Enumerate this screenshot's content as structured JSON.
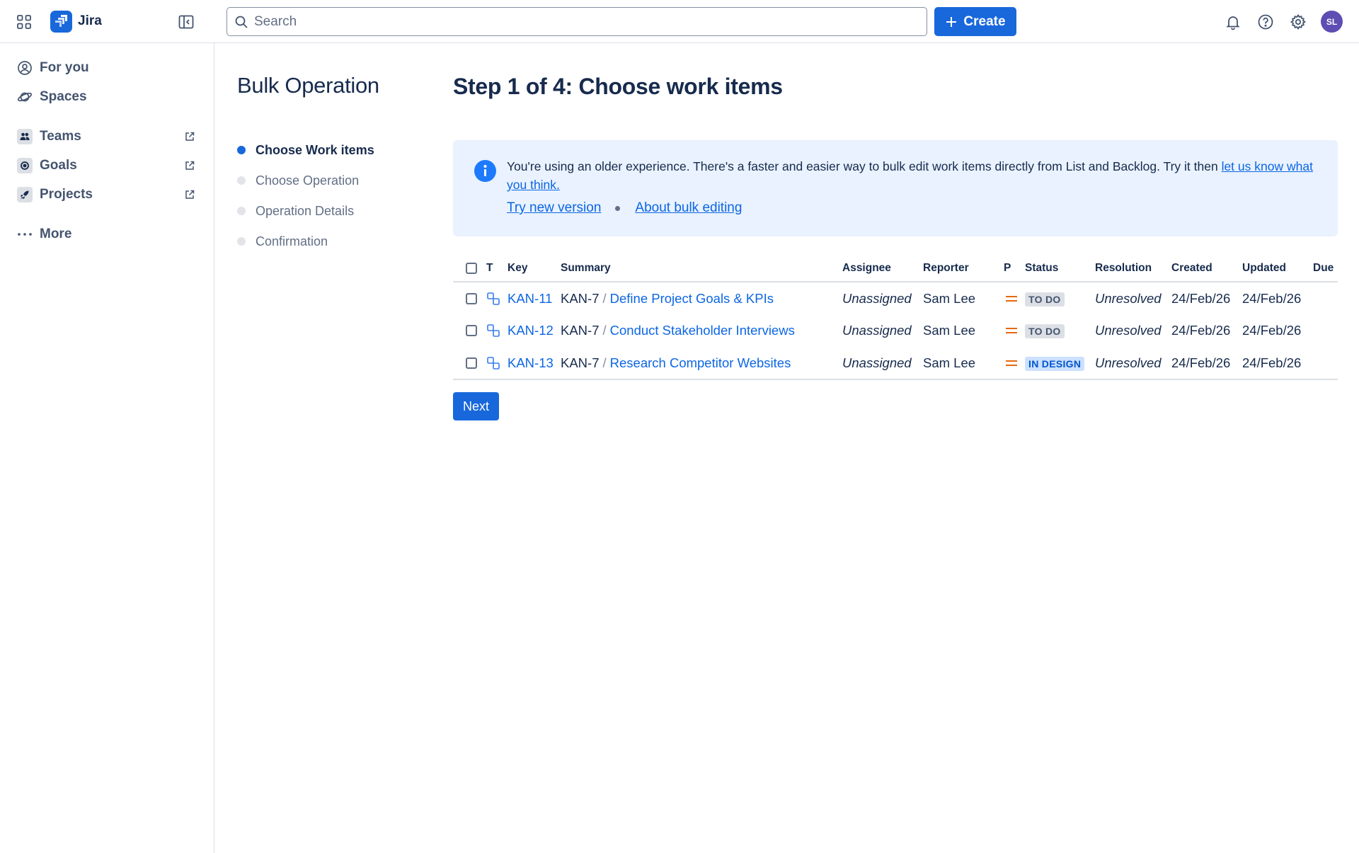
{
  "app": {
    "product_name": "Jira",
    "accent_color": "#1868db"
  },
  "topbar": {
    "search_placeholder": "Search",
    "create_label": "Create",
    "avatar_initials": "SL",
    "icons": [
      "app-switcher-icon",
      "sidebar-toggle-icon",
      "search-icon",
      "bell-icon",
      "help-icon",
      "gear-icon"
    ]
  },
  "sidebar": {
    "items": [
      {
        "label": "For you",
        "icon": "person-circle-icon"
      },
      {
        "label": "Spaces",
        "icon": "planet-icon"
      },
      {
        "label": "Teams",
        "icon": "people-icon",
        "external": true
      },
      {
        "label": "Goals",
        "icon": "target-icon",
        "external": true
      },
      {
        "label": "Projects",
        "icon": "rocket-icon",
        "external": true
      },
      {
        "label": "More",
        "icon": "more-dots-icon"
      }
    ]
  },
  "bulk": {
    "title": "Bulk Operation",
    "steps": [
      {
        "label": "Choose Work items",
        "active": true
      },
      {
        "label": "Choose Operation",
        "active": false
      },
      {
        "label": "Operation Details",
        "active": false
      },
      {
        "label": "Confirmation",
        "active": false
      }
    ]
  },
  "main": {
    "heading": "Step 1 of 4: Choose work items",
    "info": {
      "text": "You're using an older experience. There's a faster and easier way to bulk edit work items directly from List and Backlog. Try it then ",
      "feedback_link": "let us know what you think.",
      "try_link": "Try new version",
      "about_link": "About bulk editing"
    },
    "table": {
      "columns": [
        "T",
        "Key",
        "Summary",
        "Assignee",
        "Reporter",
        "P",
        "Status",
        "Resolution",
        "Created",
        "Updated",
        "Due"
      ],
      "rows": [
        {
          "key": "KAN-11",
          "parent": "KAN-7",
          "summary": "Define Project Goals & KPIs",
          "assignee": "Unassigned",
          "reporter": "Sam Lee",
          "status": "TO DO",
          "resolution": "Unresolved",
          "created": "24/Feb/26",
          "updated": "24/Feb/26",
          "due": ""
        },
        {
          "key": "KAN-12",
          "parent": "KAN-7",
          "summary": "Conduct Stakeholder Interviews",
          "assignee": "Unassigned",
          "reporter": "Sam Lee",
          "status": "TO DO",
          "resolution": "Unresolved",
          "created": "24/Feb/26",
          "updated": "24/Feb/26",
          "due": ""
        },
        {
          "key": "KAN-13",
          "parent": "KAN-7",
          "summary": "Research Competitor Websites",
          "assignee": "Unassigned",
          "reporter": "Sam Lee",
          "status": "IN DESIGN",
          "resolution": "Unresolved",
          "created": "24/Feb/26",
          "updated": "24/Feb/26",
          "due": ""
        }
      ]
    },
    "next_label": "Next"
  }
}
